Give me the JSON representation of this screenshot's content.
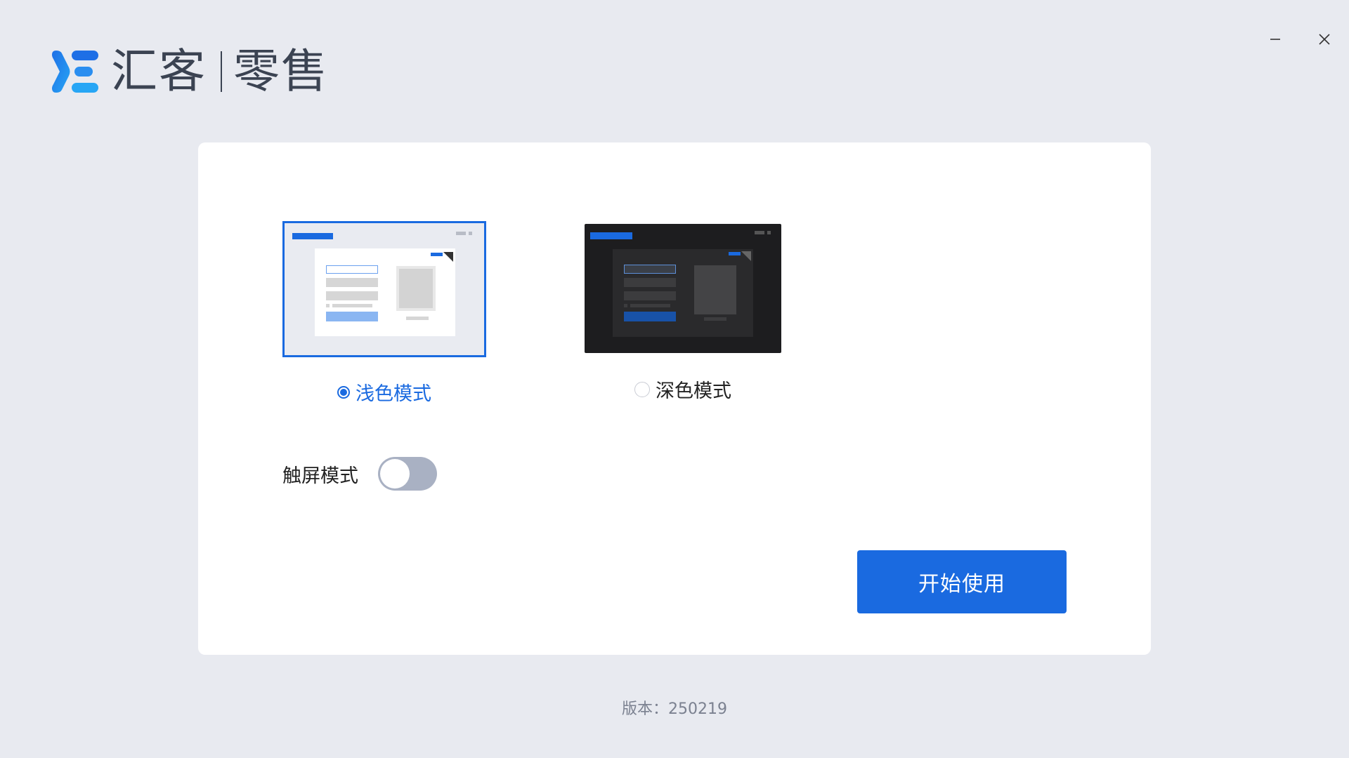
{
  "app": {
    "brand_name": "汇客",
    "product_name": "零售"
  },
  "window_controls": {
    "minimize_icon": "minimize-icon",
    "close_icon": "close-icon"
  },
  "theme": {
    "options": [
      {
        "label": "浅色模式",
        "selected": true
      },
      {
        "label": "深色模式",
        "selected": false
      }
    ]
  },
  "touch_mode": {
    "label": "触屏模式",
    "enabled": false
  },
  "start_button": {
    "label": "开始使用"
  },
  "footer": {
    "version_label": "版本：250219"
  },
  "colors": {
    "accent": "#1a6ae0",
    "background": "#e8eaf0",
    "card": "#ffffff",
    "toggle_off": "#a9b1c3",
    "dark_preview_bg": "#1d1d1f"
  }
}
